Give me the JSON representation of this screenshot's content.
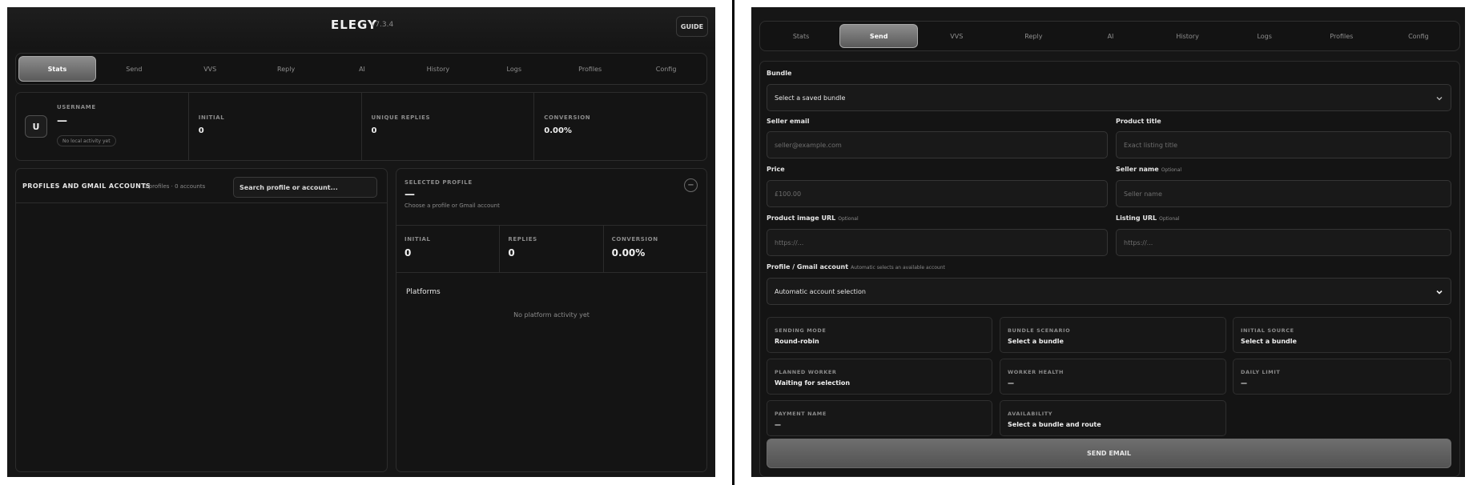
{
  "app": {
    "brand": "ELEGY",
    "version": "v7.3.4",
    "guide_label": "GUIDE"
  },
  "tabs": [
    "Stats",
    "Send",
    "VVS",
    "Reply",
    "AI",
    "History",
    "Logs",
    "Profiles",
    "Config"
  ],
  "stats_view": {
    "active_tab": "Stats",
    "user": {
      "avatar_letter": "U",
      "username_label": "USERNAME",
      "username_value": "—",
      "activity_pill": "No local activity yet"
    },
    "summary": [
      {
        "label": "INITIAL",
        "value": "0"
      },
      {
        "label": "UNIQUE REPLIES",
        "value": "0"
      },
      {
        "label": "CONVERSION",
        "value": "0.00%"
      }
    ],
    "profiles_panel": {
      "title": "PROFILES AND GMAIL ACCOUNTS",
      "count": "0 profiles · 0 accounts",
      "search_placeholder": "Search profile or account..."
    },
    "selected_profile": {
      "label": "SELECTED PROFILE",
      "value": "—",
      "hint": "Choose a profile or Gmail account",
      "stats": [
        {
          "label": "INITIAL",
          "value": "0"
        },
        {
          "label": "REPLIES",
          "value": "0"
        },
        {
          "label": "CONVERSION",
          "value": "0.00%"
        }
      ],
      "platforms_title": "Platforms",
      "platforms_empty": "No platform activity yet"
    }
  },
  "send_view": {
    "active_tab": "Send",
    "bundle": {
      "label": "Bundle",
      "value": "Select a saved bundle"
    },
    "seller_email": {
      "label": "Seller email",
      "placeholder": "seller@example.com"
    },
    "product_title": {
      "label": "Product title",
      "placeholder": "Exact listing title"
    },
    "price": {
      "label": "Price",
      "placeholder": "£100.00"
    },
    "seller_name": {
      "label": "Seller name",
      "optional": "Optional",
      "placeholder": "Seller name"
    },
    "product_image_url": {
      "label": "Product image URL",
      "optional": "Optional",
      "placeholder": "https://..."
    },
    "listing_url": {
      "label": "Listing URL",
      "optional": "Optional",
      "placeholder": "https://..."
    },
    "account": {
      "label": "Profile / Gmail account",
      "note": "Automatic selects an available account",
      "value": "Automatic account selection"
    },
    "info": [
      {
        "label": "SENDING MODE",
        "value": "Round-robin"
      },
      {
        "label": "BUNDLE SCENARIO",
        "value": "Select a bundle"
      },
      {
        "label": "INITIAL SOURCE",
        "value": "Select a bundle"
      },
      {
        "label": "PLANNED WORKER",
        "value": "Waiting for selection"
      },
      {
        "label": "WORKER HEALTH",
        "value": "—"
      },
      {
        "label": "DAILY LIMIT",
        "value": "—"
      },
      {
        "label": "PAYMENT NAME",
        "value": "—"
      },
      {
        "label": "AVAILABILITY",
        "value": "Select a bundle and route"
      }
    ],
    "send_label": "SEND EMAIL"
  }
}
